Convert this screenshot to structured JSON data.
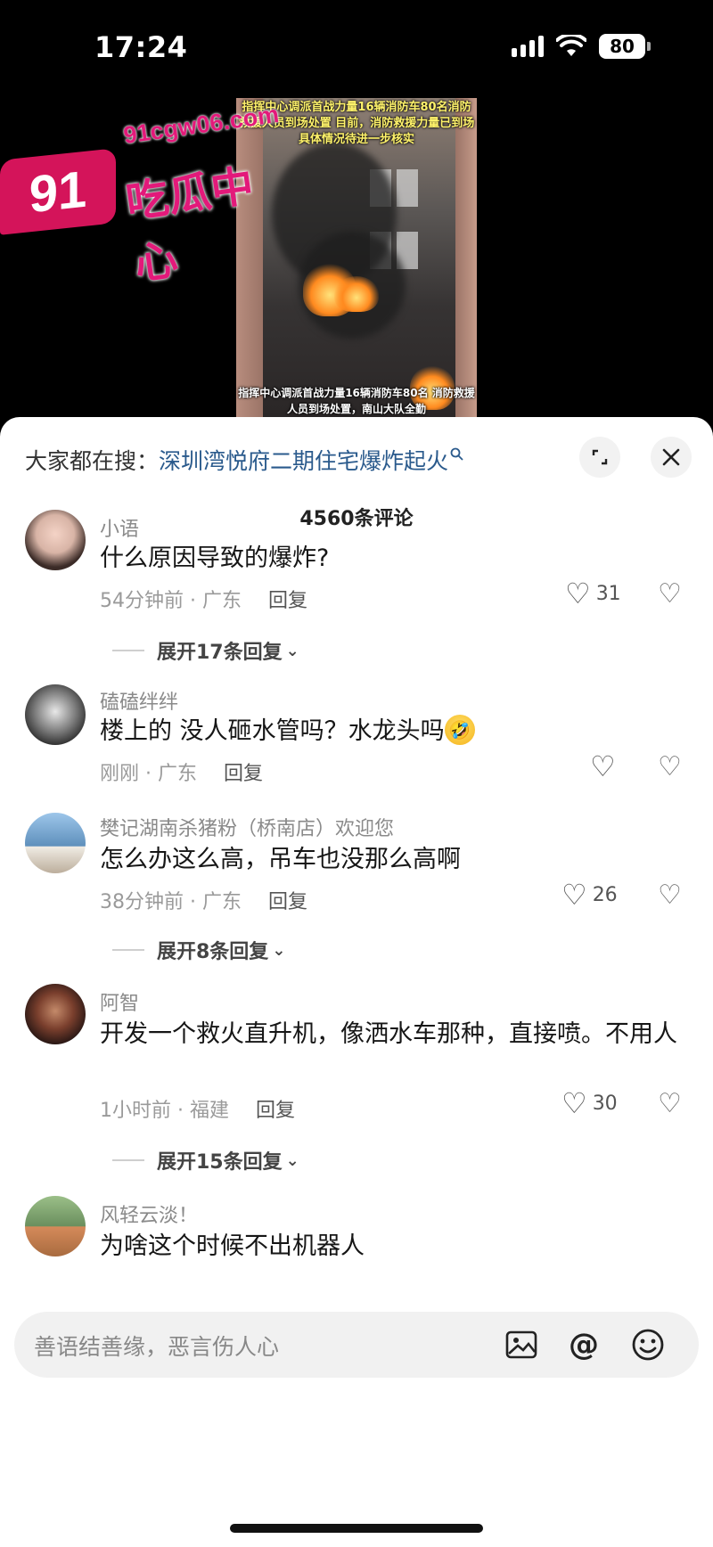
{
  "status": {
    "time": "17:24",
    "battery": "80"
  },
  "video": {
    "caption_top": "指挥中心调派首战力量16辆消防车80名消防救援人员到场处置 目前，消防救援力量已到场 具体情况待进一步核实",
    "caption_bottom": "指挥中心调派首战力量16辆消防车80名 消防救援人员到场处置，南山大队全勤"
  },
  "watermark": {
    "badge": "91",
    "site": "91cgw06.com",
    "name": "吃瓜中心"
  },
  "search": {
    "prefix": "大家都在搜：",
    "query": "深圳湾悦府二期住宅爆炸起火"
  },
  "comments_count": "4560条评论",
  "comments": [
    {
      "user": "小语",
      "text": "什么原因导致的爆炸?",
      "time": "54分钟前 · 广东",
      "reply": "回复",
      "likes": "31",
      "expand": "展开17条回复"
    },
    {
      "user": "磕磕绊绊",
      "text": "楼上的 没人砸水管吗？水龙头吗",
      "emoji": "🤣",
      "time": "刚刚 · 广东",
      "reply": "回复",
      "likes": ""
    },
    {
      "user": "樊记湖南杀猪粉（桥南店）欢迎您",
      "text": "怎么办这么高，吊车也没那么高啊",
      "time": "38分钟前 · 广东",
      "reply": "回复",
      "likes": "26",
      "expand": "展开8条回复"
    },
    {
      "user": "阿智",
      "text": "开发一个救火直升机，像洒水车那种，直接喷。不用人",
      "time": "1小时前 · 福建",
      "reply": "回复",
      "likes": "30",
      "expand": "展开15条回复"
    },
    {
      "user": "风轻云淡！",
      "text": "为啥这个时候不出机器人"
    }
  ],
  "input": {
    "placeholder": "善语结善缘，恶言伤人心"
  },
  "icons": [
    "search-icon",
    "expand-icon",
    "close-icon",
    "heart-icon",
    "dislike-icon",
    "chevron-down-icon",
    "image-icon",
    "at-icon",
    "emoji-icon"
  ]
}
